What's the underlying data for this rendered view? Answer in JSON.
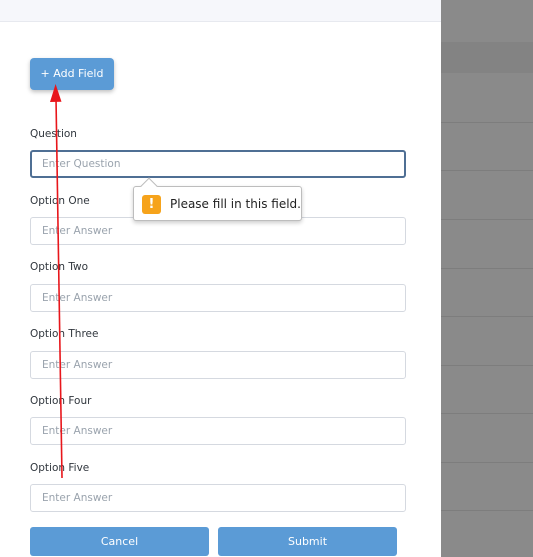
{
  "form": {
    "add_field_label": "+ Add Field",
    "question": {
      "label": "Question",
      "placeholder": "Enter Question"
    },
    "options": [
      {
        "label": "Option One",
        "placeholder": "Enter Answer"
      },
      {
        "label": "Option Two",
        "placeholder": "Enter Answer"
      },
      {
        "label": "Option Three",
        "placeholder": "Enter Answer"
      },
      {
        "label": "Option Four",
        "placeholder": "Enter Answer"
      },
      {
        "label": "Option Five",
        "placeholder": "Enter Answer"
      }
    ],
    "cancel_label": "Cancel",
    "submit_label": "Submit"
  },
  "validation_tooltip": {
    "icon": "warning-icon",
    "message": "Please fill in this field."
  },
  "annotation": {
    "icon": "red-arrow",
    "color": "#e8161b"
  },
  "colors": {
    "accent": "#5b9bd6",
    "focus_border": "#4f6f94",
    "warning": "#f6a31b"
  }
}
